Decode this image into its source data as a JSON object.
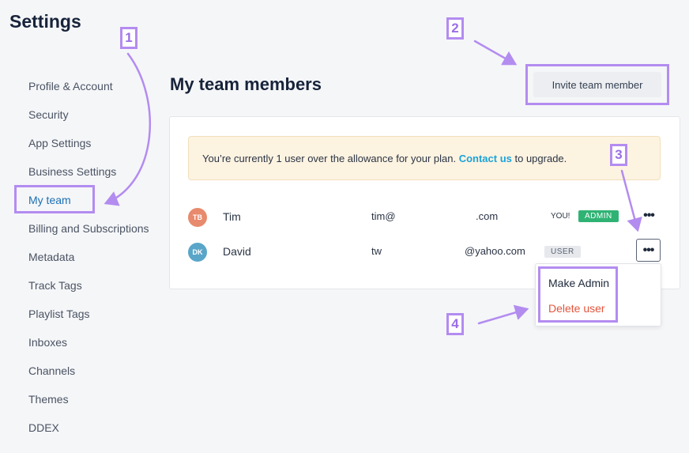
{
  "app": {
    "title": "Settings"
  },
  "sidebar": {
    "items": [
      {
        "label": "Profile & Account"
      },
      {
        "label": "Security"
      },
      {
        "label": "App Settings"
      },
      {
        "label": "Business Settings"
      },
      {
        "label": "My team",
        "active": true
      },
      {
        "label": "Billing and Subscriptions"
      },
      {
        "label": "Metadata"
      },
      {
        "label": "Track Tags"
      },
      {
        "label": "Playlist Tags"
      },
      {
        "label": "Inboxes"
      },
      {
        "label": "Channels"
      },
      {
        "label": "Themes"
      },
      {
        "label": "DDEX"
      }
    ]
  },
  "main": {
    "title": "My team members",
    "invite_label": "Invite team member",
    "banner": {
      "text_before": "You’re currently 1 user over the allowance for your plan. ",
      "link": "Contact us",
      "text_after": " to upgrade."
    },
    "members": [
      {
        "initials": "TB",
        "avatar_color": "#e88a6d",
        "name": "Tim",
        "email_left": "tim@",
        "email_right": ".com",
        "you": "YOU!",
        "role": "ADMIN",
        "menu": "•••"
      },
      {
        "initials": "DK",
        "avatar_color": "#5aa6c9",
        "name": "David",
        "email_left": "tw",
        "email_right": "@yahoo.com",
        "role": "USER",
        "menu": "•••"
      }
    ],
    "menu": {
      "make_admin": "Make Admin",
      "delete_user": "Delete user"
    }
  },
  "annotations": {
    "accent": "#b38cf0",
    "labels": [
      "1",
      "2",
      "3",
      "4"
    ]
  }
}
